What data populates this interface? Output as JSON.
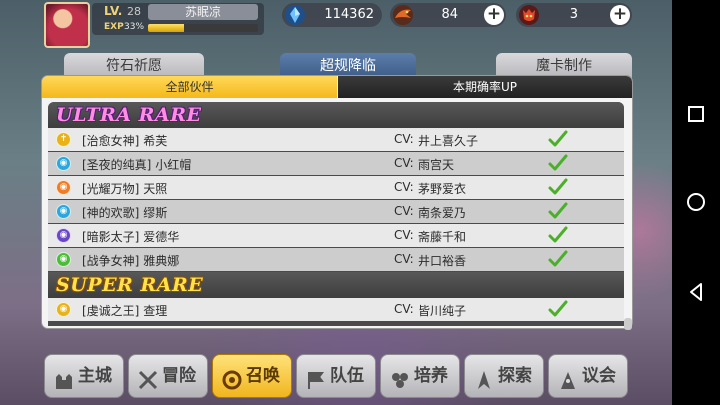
{
  "player": {
    "level_label": "LV.",
    "level": "28",
    "name": "苏眠凉",
    "exp_label": "EXP",
    "exp_percent": "33%",
    "exp_fraction": 0.33
  },
  "resources": [
    {
      "icon": "blue-crystal-icon",
      "value": "114362",
      "color": "#3a8de0"
    },
    {
      "icon": "dragon-icon",
      "value": "84",
      "color": "#c0502a"
    },
    {
      "icon": "demon-mask-icon",
      "value": "3",
      "color": "#d0402a"
    }
  ],
  "plus_symbol": "+",
  "category_tabs": [
    {
      "label": "符石祈愿",
      "active": false
    },
    {
      "label": "超规降临",
      "active": true
    },
    {
      "label": "魔卡制作",
      "active": false
    }
  ],
  "sub_tabs": {
    "all": "全部伙伴",
    "up": "本期确率UP"
  },
  "rarities": {
    "ultra": "ULTRA RARE",
    "super": "SUPER RARE"
  },
  "cv_label": "CV:",
  "ultra_rare": [
    {
      "title": "[治愈女神]",
      "name": "希芙",
      "cv": "井上喜久子",
      "element_color": "#e8b21a",
      "element_glyph": "✝"
    },
    {
      "title": "[圣夜的纯真]",
      "name": "小红帽",
      "cv": "雨宫天",
      "element_color": "#2aa7dd",
      "element_glyph": "◉"
    },
    {
      "title": "[光耀万物]",
      "name": "天照",
      "cv": "茅野爱衣",
      "element_color": "#f07c24",
      "element_glyph": "◉"
    },
    {
      "title": "[神的欢歌]",
      "name": "缪斯",
      "cv": "南条爱乃",
      "element_color": "#2aa7dd",
      "element_glyph": "◉"
    },
    {
      "title": "[暗影太子]",
      "name": "爱德华",
      "cv": "斋藤千和",
      "element_color": "#6b45c8",
      "element_glyph": "◉"
    },
    {
      "title": "[战争女神]",
      "name": "雅典娜",
      "cv": "井口裕香",
      "element_color": "#4cbb3a",
      "element_glyph": "◉"
    }
  ],
  "super_rare": [
    {
      "title": "[虔诚之王]",
      "name": "查理",
      "cv": "皆川纯子",
      "element_color": "#e8b21a",
      "element_glyph": "◉"
    }
  ],
  "menu": [
    {
      "label": "主城",
      "icon": "castle-icon",
      "active": false
    },
    {
      "label": "冒险",
      "icon": "crossed-swords-icon",
      "active": false
    },
    {
      "label": "召唤",
      "icon": "summon-circle-icon",
      "active": true
    },
    {
      "label": "队伍",
      "icon": "team-flag-icon",
      "active": false
    },
    {
      "label": "培养",
      "icon": "nurture-icon",
      "active": false
    },
    {
      "label": "探索",
      "icon": "explore-icon",
      "active": false
    },
    {
      "label": "议会",
      "icon": "council-icon",
      "active": false
    }
  ],
  "colors": {
    "accent": "#f4b91a",
    "check": "#4caf2a"
  }
}
